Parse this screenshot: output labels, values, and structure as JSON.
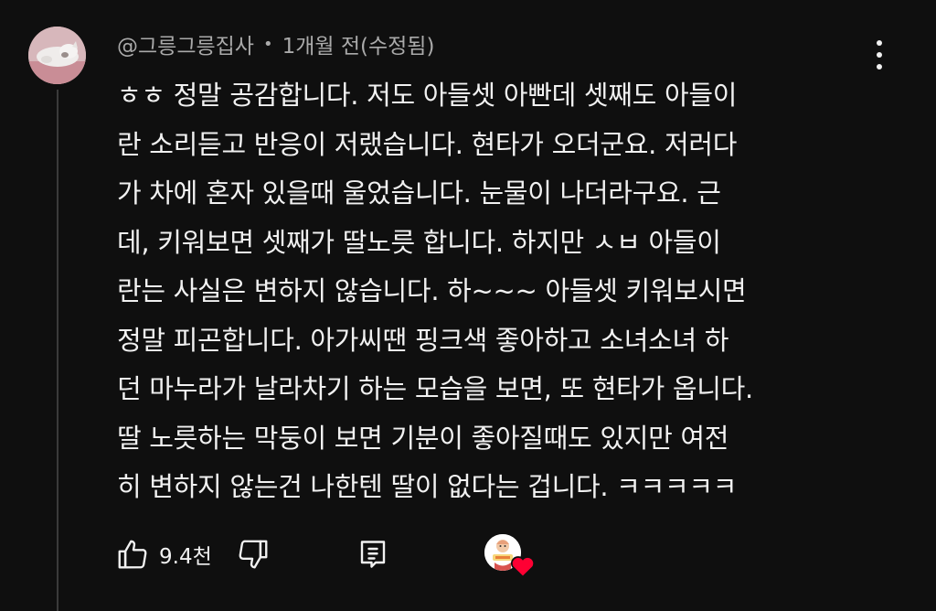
{
  "comment": {
    "author": "@그릉그릉집사",
    "separator": "•",
    "timestamp": "1개월 전(수정됨)",
    "lines": [
      "ㅎㅎ 정말 공감합니다. 저도 아들셋 아빤데 셋째도 아들이",
      "란 소리듣고 반응이 저랬습니다. 현타가 오더군요. 저러다",
      "가 차에 혼자 있을때 울었습니다. 눈물이 나더라구요. 근",
      "데, 키워보면 셋째가 딸노릇 합니다. 하지만 ㅅㅂ 아들이",
      "란는 사실은 변하지 않습니다. 하~~~ 아들셋 키워보시면",
      "정말 피곤합니다. 아가씨땐 핑크색 좋아하고 소녀소녀 하",
      "던 마누라가 날라차기 하는 모습을 보면, 또 현타가 옵니다.",
      "딸 노릇하는 막둥이 보면 기분이 좋아질때도 있지만 여전",
      "히 변하지 않는건 나한텐 딸이 없다는 겁니다. ㅋㅋㅋㅋㅋ"
    ],
    "like_count": "9.4천",
    "icons": {
      "like": "thumbs-up-icon",
      "dislike": "thumbs-down-icon",
      "reply": "reply-icon",
      "more": "more-vertical-icon",
      "creator_heart": "heart-icon"
    },
    "colors": {
      "background": "#0f0f0f",
      "text": "#f1f1f1",
      "meta": "#aaaaaa",
      "heart": "#ff0033"
    }
  }
}
